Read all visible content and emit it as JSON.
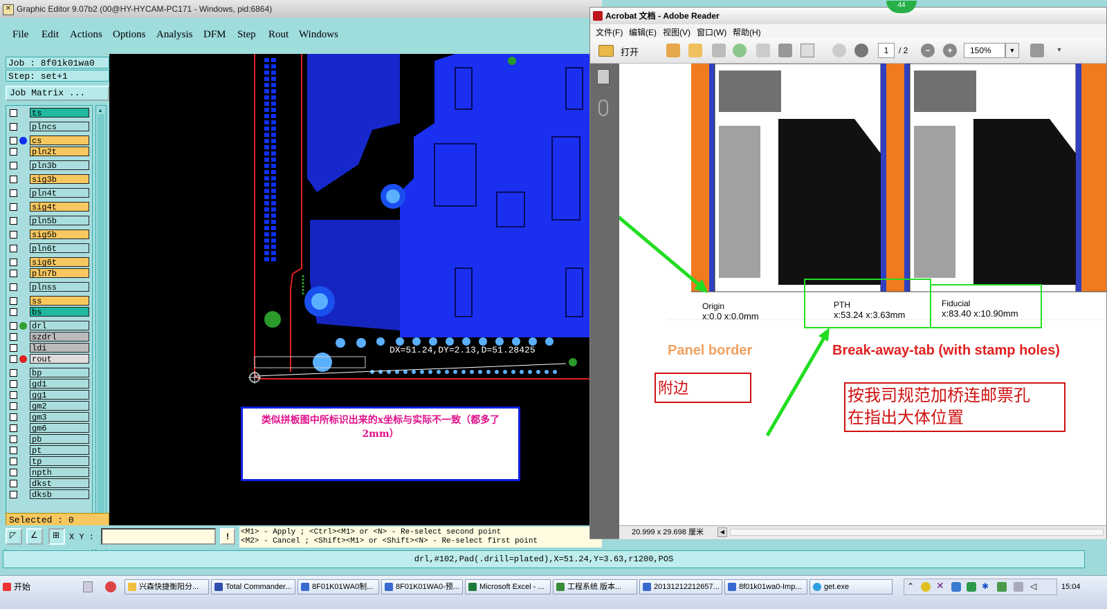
{
  "graphic_editor": {
    "title": "Graphic Editor 9.07b2 (00@HY-HYCAM-PC171 - Windows, pid:6864)",
    "menu": [
      "File",
      "Edit",
      "Actions",
      "Options",
      "Analysis",
      "DFM",
      "Step",
      "Rout",
      "Windows"
    ],
    "job": "Job : 8f01k01wa0",
    "step": "Step: set+1",
    "job_matrix_label": "Job Matrix ...",
    "layers": [
      {
        "name": "ts",
        "color": "#20b8a0",
        "dot": ""
      },
      {
        "name": "plncs",
        "color": "#aadede",
        "dot": ""
      },
      {
        "name": "cs",
        "color": "#f8c860",
        "dot": "#1030f0"
      },
      {
        "name": "pln2t",
        "color": "#f8c860",
        "dot": ""
      },
      {
        "name": "pln3b",
        "color": "#aadede",
        "dot": ""
      },
      {
        "name": "sig3b",
        "color": "#f8c860",
        "dot": ""
      },
      {
        "name": "pln4t",
        "color": "#aadede",
        "dot": ""
      },
      {
        "name": "sig4t",
        "color": "#f8c860",
        "dot": ""
      },
      {
        "name": "pln5b",
        "color": "#aadede",
        "dot": ""
      },
      {
        "name": "sig5b",
        "color": "#f8c860",
        "dot": ""
      },
      {
        "name": "pln6t",
        "color": "#aadede",
        "dot": ""
      },
      {
        "name": "sig6t",
        "color": "#f8c860",
        "dot": ""
      },
      {
        "name": "pln7b",
        "color": "#f8c860",
        "dot": ""
      },
      {
        "name": "plnss",
        "color": "#aadede",
        "dot": ""
      },
      {
        "name": "ss",
        "color": "#f8c860",
        "dot": ""
      },
      {
        "name": "bs",
        "color": "#20b8a0",
        "dot": ""
      },
      {
        "name": "drl",
        "color": "#aadede",
        "dot": "#30a030"
      },
      {
        "name": "szdrl",
        "color": "#bbbbbb",
        "dot": ""
      },
      {
        "name": "ldi",
        "color": "#bbbbbb",
        "dot": ""
      },
      {
        "name": "rout",
        "color": "#dddddd",
        "dot": "#e02020"
      },
      {
        "name": "bp",
        "color": "#aadede",
        "dot": ""
      },
      {
        "name": "gd1",
        "color": "#aadede",
        "dot": ""
      },
      {
        "name": "gg1",
        "color": "#aadede",
        "dot": ""
      },
      {
        "name": "gm2",
        "color": "#aadede",
        "dot": ""
      },
      {
        "name": "gm3",
        "color": "#aadede",
        "dot": ""
      },
      {
        "name": "gm6",
        "color": "#aadede",
        "dot": ""
      },
      {
        "name": "pb",
        "color": "#aadede",
        "dot": ""
      },
      {
        "name": "pt",
        "color": "#aadede",
        "dot": ""
      },
      {
        "name": "tp",
        "color": "#aadede",
        "dot": ""
      },
      {
        "name": "npth",
        "color": "#aadede",
        "dot": ""
      },
      {
        "name": "dkst",
        "color": "#aadede",
        "dot": ""
      },
      {
        "name": "dksb",
        "color": "#aadede",
        "dot": ""
      }
    ],
    "selected": "Selected : 0",
    "measure_text": "DX=51.24,DY=2.13,D=51.28425",
    "note_text": "类似拼板图中所标识出来的x坐标与实际不一致（都多了2mm）",
    "xy_label": "X Y :",
    "xy_value": "",
    "bang": "!",
    "hint_line1": "<M1> - Apply  ; <Ctrl><M1> or <N> - Re-select second point",
    "hint_line2": "<M2> - Cancel ; <Shift><M1> or <Shift><N> - Re-select first point",
    "status": "drl,#102,Pad(.drill=plated),X=51.24,Y=3.63,r1200,POS"
  },
  "acrobat": {
    "title": "Acrobat 文档 - Adobe Reader",
    "badge": "44",
    "menu": [
      "文件(F)",
      "编辑(E)",
      "视图(V)",
      "窗口(W)",
      "帮助(H)"
    ],
    "open_label": "打开",
    "page_current": "1",
    "page_total": "/ 2",
    "zoom": "150%",
    "doc": {
      "origin_label": "Origin",
      "origin_coords": "x:0.0 x:0.0mm",
      "pth_label": "PTH",
      "pth_coords": "x:53.24 x:3.63mm",
      "fiducial_label": "Fiducial",
      "fiducial_coords": "x:83.40 x:10.90mm",
      "panel_border": "Panel border",
      "breakaway": "Break-away-tab (with stamp holes)",
      "fubian": "附边",
      "note_line1": "按我司规范加桥连邮票孔",
      "note_line2": "在指出大体位置"
    },
    "page_size": "20.999 x 29.698 厘米"
  },
  "taskbar": {
    "start": "开始",
    "tasks": [
      "兴森快捷衡阳分...",
      "Total Commander...",
      "8F01K01WA0制...",
      "8F01K01WA0-预...",
      "Microsoft Excel - ...",
      "工程系统  版本...",
      "20131212212657...",
      "8f01k01wa0-Imp...",
      "get.exe"
    ],
    "clock": "15:04"
  }
}
